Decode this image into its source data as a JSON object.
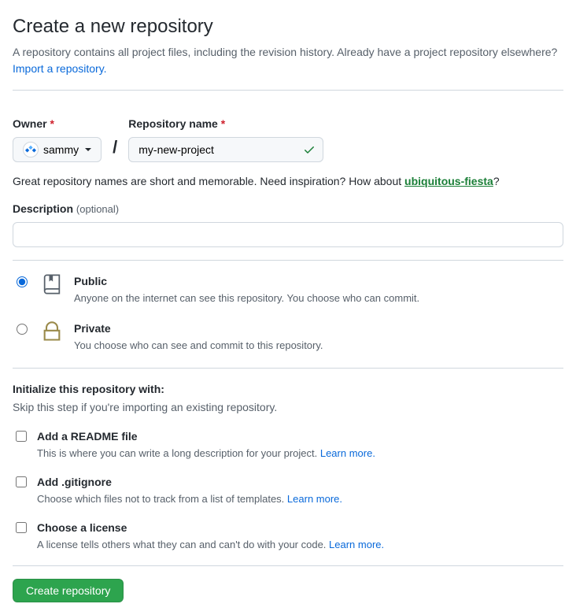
{
  "header": {
    "title": "Create a new repository",
    "subhead_prefix": "A repository contains all project files, including the revision history. Already have a project repository elsewhere? ",
    "import_link": "Import a repository."
  },
  "owner": {
    "label": "Owner",
    "username": "sammy"
  },
  "repo": {
    "label": "Repository name",
    "value": "my-new-project"
  },
  "hint": {
    "prefix": "Great repository names are short and memorable. Need inspiration? How about ",
    "suggestion": "ubiquitous-fiesta",
    "suffix": "?"
  },
  "description": {
    "label": "Description",
    "optional": "(optional)",
    "value": ""
  },
  "visibility": {
    "public": {
      "title": "Public",
      "sub": "Anyone on the internet can see this repository. You choose who can commit."
    },
    "private": {
      "title": "Private",
      "sub": "You choose who can see and commit to this repository."
    }
  },
  "init": {
    "heading": "Initialize this repository with:",
    "sub": "Skip this step if you're importing an existing repository.",
    "readme": {
      "title": "Add a README file",
      "sub": "This is where you can write a long description for your project. ",
      "learn": "Learn more."
    },
    "gitignore": {
      "title": "Add .gitignore",
      "sub": "Choose which files not to track from a list of templates. ",
      "learn": "Learn more."
    },
    "license": {
      "title": "Choose a license",
      "sub": "A license tells others what they can and can't do with your code. ",
      "learn": "Learn more."
    }
  },
  "submit": {
    "label": "Create repository"
  }
}
